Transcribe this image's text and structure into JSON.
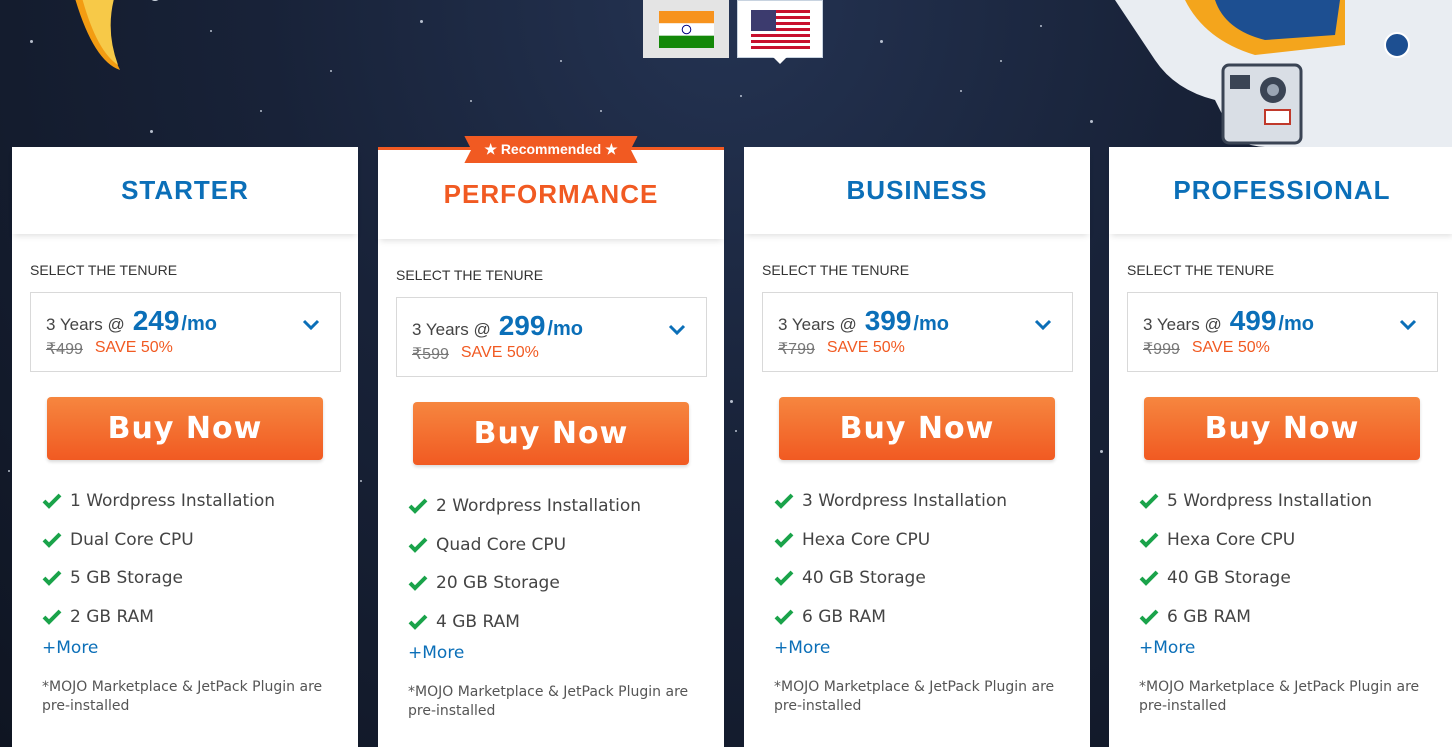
{
  "currency_tabs": [
    {
      "flag": "india-flag-icon",
      "active": false
    },
    {
      "flag": "usa-flag-icon",
      "active": true
    }
  ],
  "plans": [
    {
      "name": "STARTER",
      "badge": "",
      "tenure_label": "SELECT THE TENURE",
      "tenure": "3 Years @",
      "price": "249",
      "per": "/mo",
      "old_price": "₹499",
      "save": "SAVE 50%",
      "cta": "Buy Now",
      "features": [
        "1 Wordpress Installation",
        "Dual Core CPU",
        "5 GB Storage",
        "2 GB RAM"
      ],
      "more": "+More",
      "note": "*MOJO Marketplace & JetPack Plugin are pre-installed"
    },
    {
      "name": "PERFORMANCE",
      "badge": "★ Recommended ★",
      "tenure_label": "SELECT THE TENURE",
      "tenure": "3 Years @",
      "price": "299",
      "per": "/mo",
      "old_price": "₹599",
      "save": "SAVE 50%",
      "cta": "Buy Now",
      "features": [
        "2 Wordpress Installation",
        "Quad Core CPU",
        "20 GB Storage",
        "4 GB RAM"
      ],
      "more": "+More",
      "note": "*MOJO Marketplace & JetPack Plugin are pre-installed"
    },
    {
      "name": "BUSINESS",
      "badge": "",
      "tenure_label": "SELECT THE TENURE",
      "tenure": "3 Years @",
      "price": "399",
      "per": "/mo",
      "old_price": "₹799",
      "save": "SAVE 50%",
      "cta": "Buy Now",
      "features": [
        "3 Wordpress Installation",
        "Hexa Core CPU",
        "40 GB Storage",
        "6 GB RAM"
      ],
      "more": "+More",
      "note": "*MOJO Marketplace & JetPack Plugin are pre-installed"
    },
    {
      "name": "PROFESSIONAL",
      "badge": "",
      "tenure_label": "SELECT THE TENURE",
      "tenure": "3 Years @",
      "price": "499",
      "per": "/mo",
      "old_price": "₹999",
      "save": "SAVE 50%",
      "cta": "Buy Now",
      "features": [
        "5 Wordpress Installation",
        "Hexa Core CPU",
        "40 GB Storage",
        "6 GB RAM"
      ],
      "more": "+More",
      "note": "*MOJO Marketplace & JetPack Plugin are pre-installed"
    }
  ],
  "colors": {
    "accent": "#f15a22",
    "brand_blue": "#0b6fb8",
    "check_green": "#1aa34a"
  }
}
